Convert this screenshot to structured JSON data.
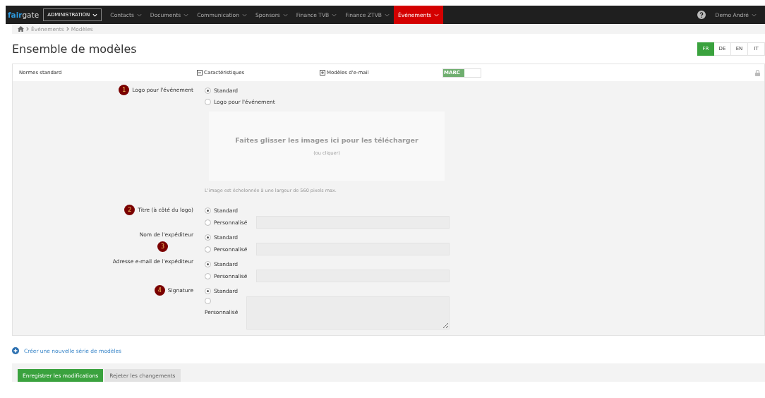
{
  "navbar": {
    "logo_a": "fair",
    "logo_b": "gate",
    "admin": "ADMINISTRATION",
    "menu": [
      {
        "label": "Contacts",
        "selected": false
      },
      {
        "label": "Documents",
        "selected": false
      },
      {
        "label": "Communication",
        "selected": false
      },
      {
        "label": "Sponsors",
        "selected": false
      },
      {
        "label": "Finance TVB",
        "selected": false
      },
      {
        "label": "Finance ZTVB",
        "selected": false
      },
      {
        "label": "Événements",
        "selected": true
      }
    ],
    "user": "Demo André"
  },
  "breadcrumb": [
    "Événements",
    "Modèles"
  ],
  "title": "Ensemble de modèles",
  "languages": [
    {
      "label": "FR",
      "selected": true
    },
    {
      "label": "DE",
      "selected": false
    },
    {
      "label": "EN",
      "selected": false
    },
    {
      "label": "IT",
      "selected": false
    }
  ],
  "panel_header": {
    "name": "Normes standard",
    "features": "Caractéristiques",
    "features_expanded": true,
    "email_templates": "Modèles d'e-mail",
    "email_templates_expanded": false,
    "toggle_text": "MARC",
    "toggle_on": true,
    "locked": true
  },
  "fields": [
    {
      "kind": "logo",
      "label": "Logo pour l'événement",
      "badge": "1",
      "badge_below": false,
      "options": [
        {
          "label": "Standard",
          "selected": true
        },
        {
          "label": "Logo pour l'événement",
          "selected": false
        }
      ],
      "dropzone": "Faites glisser les images ici pour les télécharger",
      "dropzone_hint": "(ou cliquer)",
      "note": "L'image est échelonnée à une largeur de 560 pixels max."
    },
    {
      "kind": "text",
      "label": "Titre (à côté du logo)",
      "badge": "2",
      "badge_below": false,
      "options": [
        {
          "label": "Standard",
          "selected": true
        },
        {
          "label": "Personnalisé",
          "selected": false
        }
      ]
    },
    {
      "kind": "text",
      "label": "Nom de l'expéditeur",
      "badge": "3",
      "badge_below": true,
      "options": [
        {
          "label": "Standard",
          "selected": true
        },
        {
          "label": "Personnalisé",
          "selected": false
        }
      ]
    },
    {
      "kind": "text",
      "label": "Adresse e-mail de l'expéditeur",
      "options": [
        {
          "label": "Standard",
          "selected": true
        },
        {
          "label": "Personnalisé",
          "selected": false
        }
      ]
    },
    {
      "kind": "textarea",
      "label": "Signature",
      "badge": "4",
      "badge_below": false,
      "options": [
        {
          "label": "Standard",
          "selected": true
        },
        {
          "label": "Personnalisé",
          "selected": false
        }
      ]
    }
  ],
  "create_link": "Créer une nouvelle série de modèles",
  "buttons": [
    {
      "label": "Enregistrer les modifications",
      "kind": "primary"
    },
    {
      "label": "Rejeter les changements",
      "kind": "secondary"
    }
  ]
}
